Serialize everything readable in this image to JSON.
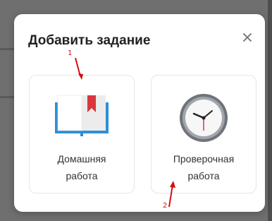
{
  "dialog": {
    "title": "Добавить задание",
    "close_symbol": "×"
  },
  "options": [
    {
      "line1": "Домашняя",
      "line2": "работа",
      "icon": "book-icon"
    },
    {
      "line1": "Проверочная",
      "line2": "работа",
      "icon": "clock-icon"
    }
  ],
  "annotations": [
    {
      "number": "1",
      "color": "#d01010"
    },
    {
      "number": "2",
      "color": "#d01010"
    }
  ],
  "colors": {
    "book_blue": "#2e8fd6",
    "bookmark_red": "#d9363e",
    "clock_face": "#f7f7f7",
    "clock_rim": "#7b7f86"
  }
}
